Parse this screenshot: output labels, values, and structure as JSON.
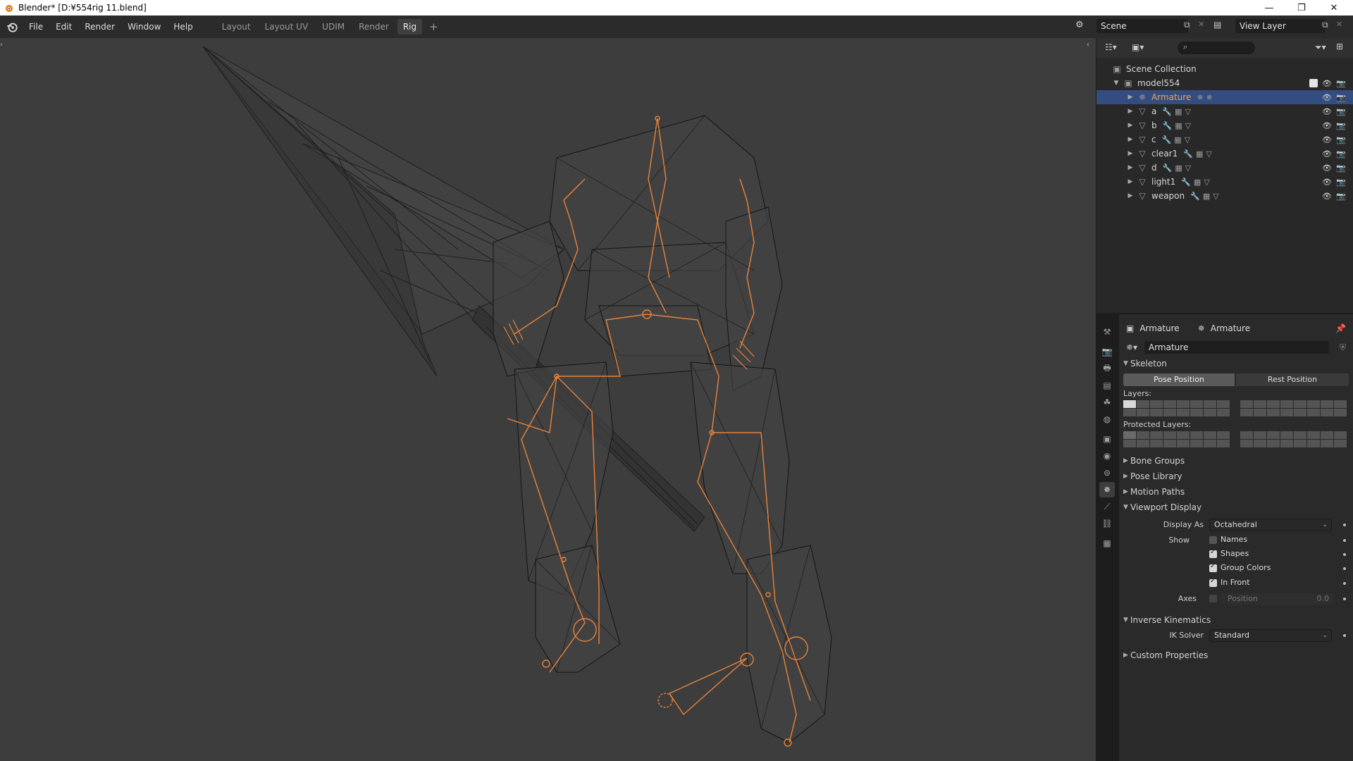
{
  "window": {
    "title": "Blender* [D:¥554rig 11.blend]",
    "minimize": "—",
    "maximize": "❐",
    "close": "✕"
  },
  "menubar": {
    "menus": [
      "File",
      "Edit",
      "Render",
      "Window",
      "Help"
    ],
    "workspaces": [
      "Layout",
      "Layout UV",
      "UDIM",
      "Render",
      "Rig"
    ],
    "active_workspace": "Rig",
    "add_workspace": "+",
    "scene": "Scene",
    "view_layer": "View Layer"
  },
  "outliner": {
    "scene_collection": "Scene Collection",
    "collection": "model554",
    "items": [
      {
        "name": "Armature",
        "selected": true,
        "type": "armature"
      },
      {
        "name": "a",
        "selected": false,
        "type": "mesh"
      },
      {
        "name": "b",
        "selected": false,
        "type": "mesh"
      },
      {
        "name": "c",
        "selected": false,
        "type": "mesh"
      },
      {
        "name": "clear1",
        "selected": false,
        "type": "mesh"
      },
      {
        "name": "d",
        "selected": false,
        "type": "mesh"
      },
      {
        "name": "light1",
        "selected": false,
        "type": "mesh"
      },
      {
        "name": "weapon",
        "selected": false,
        "type": "mesh"
      }
    ]
  },
  "properties": {
    "breadcrumb_object": "Armature",
    "breadcrumb_data": "Armature",
    "datablock_name": "Armature",
    "skeleton": {
      "title": "Skeleton",
      "pose_position": "Pose Position",
      "rest_position": "Rest Position",
      "layers_label": "Layers:",
      "protected_layers_label": "Protected Layers:"
    },
    "collapsed_sections": [
      "Bone Groups",
      "Pose Library",
      "Motion Paths"
    ],
    "viewport_display": {
      "title": "Viewport Display",
      "display_as_label": "Display As",
      "display_as_value": "Octahedral",
      "show_label": "Show",
      "names": {
        "label": "Names",
        "checked": false
      },
      "shapes": {
        "label": "Shapes",
        "checked": true
      },
      "group_colors": {
        "label": "Group Colors",
        "checked": true
      },
      "in_front": {
        "label": "In Front",
        "checked": true
      },
      "axes_label": "Axes",
      "position_label": "Position",
      "position_value": "0.0"
    },
    "inverse_kinematics": {
      "title": "Inverse Kinematics",
      "ik_solver_label": "IK Solver",
      "ik_solver_value": "Standard"
    },
    "custom_properties": "Custom Properties"
  },
  "colors": {
    "accent_selected": "#334d80",
    "bone_orange": "#e8833a",
    "active_text": "#f0a050"
  }
}
